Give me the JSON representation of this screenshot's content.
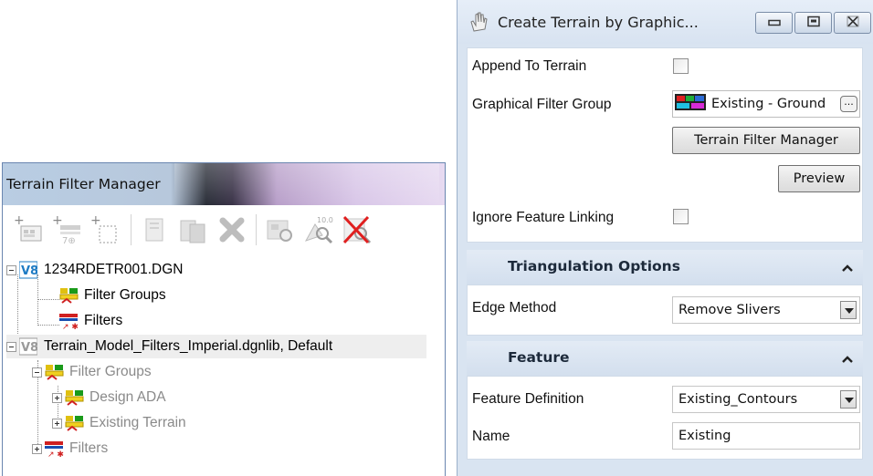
{
  "filter_manager": {
    "title": "Terrain Filter Manager",
    "toolbar": [
      {
        "name": "new-group-icon"
      },
      {
        "name": "new-filter-icon"
      },
      {
        "name": "new-selection-filter-icon"
      },
      {
        "name": "copy-icon"
      },
      {
        "name": "paste-icon"
      },
      {
        "name": "delete-icon"
      },
      {
        "name": "preview-filter-icon"
      },
      {
        "name": "test-filter-icon"
      },
      {
        "name": "clear-preview-icon"
      }
    ],
    "tree": {
      "file1": "1234RDETR001.DGN",
      "file1_groups": "Filter Groups",
      "file1_filters": "Filters",
      "lib": "Terrain_Model_Filters_Imperial.dgnlib, Default",
      "lib_groups": "Filter Groups",
      "design_ada": "Design ADA",
      "existing_terrain": "Existing Terrain",
      "lib_filters": "Filters"
    }
  },
  "dialog": {
    "title": "Create Terrain by Graphic...",
    "append_label": "Append To Terrain",
    "filter_group_label": "Graphical Filter Group",
    "filter_group_value": "Existing - Ground",
    "browse_label": "...",
    "filter_manager_button": "Terrain Filter Manager",
    "preview_button": "Preview",
    "ignore_linking_label": "Ignore Feature Linking",
    "triangulation": {
      "header": "Triangulation Options",
      "edge_label": "Edge Method",
      "edge_value": "Remove Slivers"
    },
    "feature": {
      "header": "Feature",
      "definition_label": "Feature Definition",
      "definition_value": "Existing_Contours",
      "name_label": "Name",
      "name_value": "Existing"
    },
    "colors": {
      "panel_bg": "#d9e4f1",
      "header_bg": "#d3dfee"
    }
  }
}
